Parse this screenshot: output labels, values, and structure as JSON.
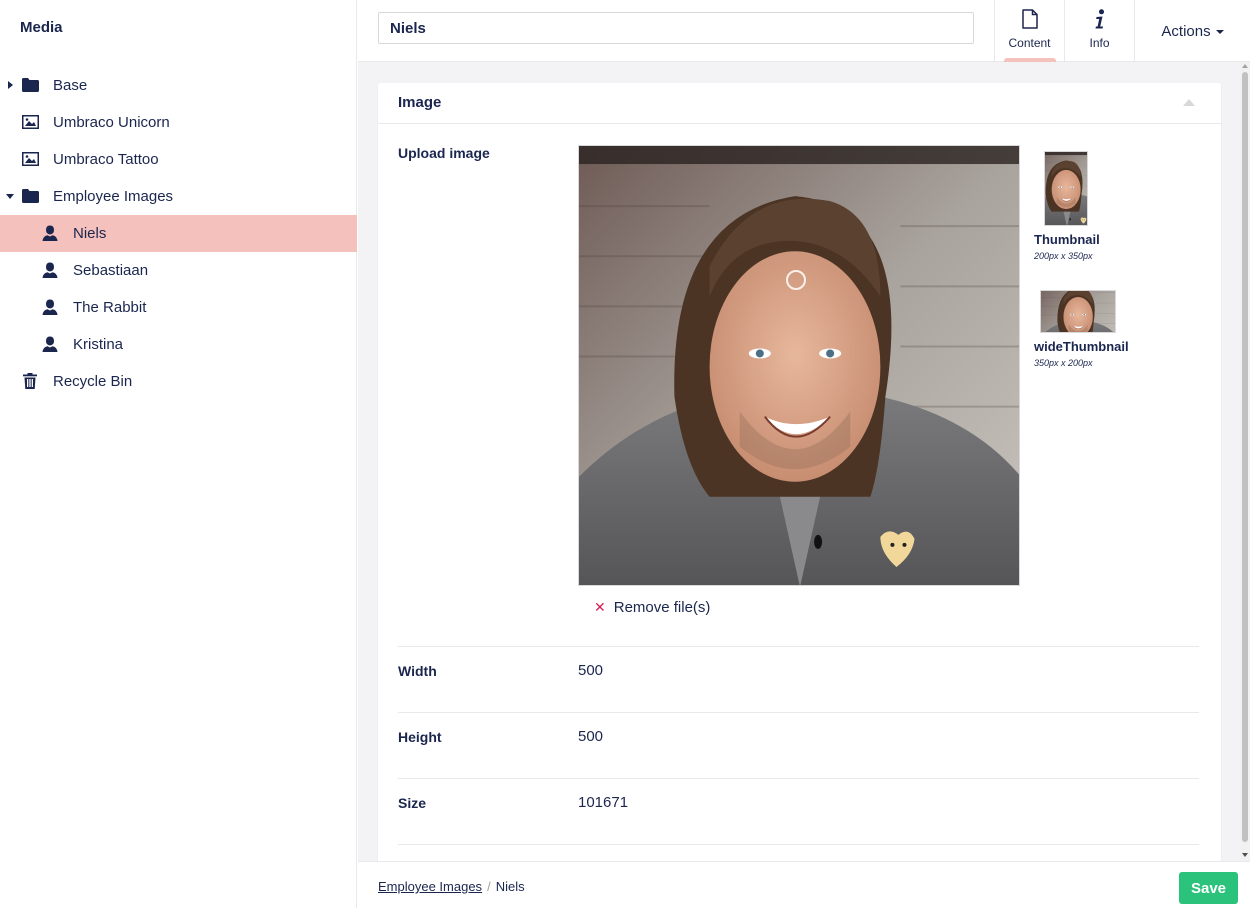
{
  "sidebar": {
    "title": "Media",
    "items": [
      {
        "label": "Base",
        "icon": "folder-icon"
      },
      {
        "label": "Umbraco Unicorn",
        "icon": "image-icon"
      },
      {
        "label": "Umbraco Tattoo",
        "icon": "image-icon"
      },
      {
        "label": "Employee Images",
        "icon": "folder-icon"
      },
      {
        "label": "Niels",
        "icon": "user-icon"
      },
      {
        "label": "Sebastiaan",
        "icon": "user-icon"
      },
      {
        "label": "The Rabbit",
        "icon": "user-icon"
      },
      {
        "label": "Kristina",
        "icon": "user-icon"
      },
      {
        "label": "Recycle Bin",
        "icon": "trash-icon"
      }
    ]
  },
  "header": {
    "name_value": "Niels",
    "tabs": [
      {
        "label": "Content",
        "icon": "document-icon"
      },
      {
        "label": "Info",
        "icon": "info-icon"
      }
    ],
    "actions_label": "Actions"
  },
  "panel": {
    "title": "Image",
    "upload": {
      "label": "Upload image",
      "remove_label": "Remove file(s)",
      "crops": [
        {
          "name": "Thumbnail",
          "dims": "200px x 350px"
        },
        {
          "name": "wideThumbnail",
          "dims": "350px x 200px"
        }
      ]
    },
    "properties": [
      {
        "label": "Width",
        "value": "500"
      },
      {
        "label": "Height",
        "value": "500"
      },
      {
        "label": "Size",
        "value": "101671"
      }
    ]
  },
  "footer": {
    "breadcrumb": [
      "Employee Images",
      "Niels"
    ],
    "save_label": "Save"
  },
  "colors": {
    "brand_navy": "#1b264f",
    "active_pink": "#f5c1bc",
    "save_green": "#2bc37c",
    "remove_red": "#d42054"
  }
}
